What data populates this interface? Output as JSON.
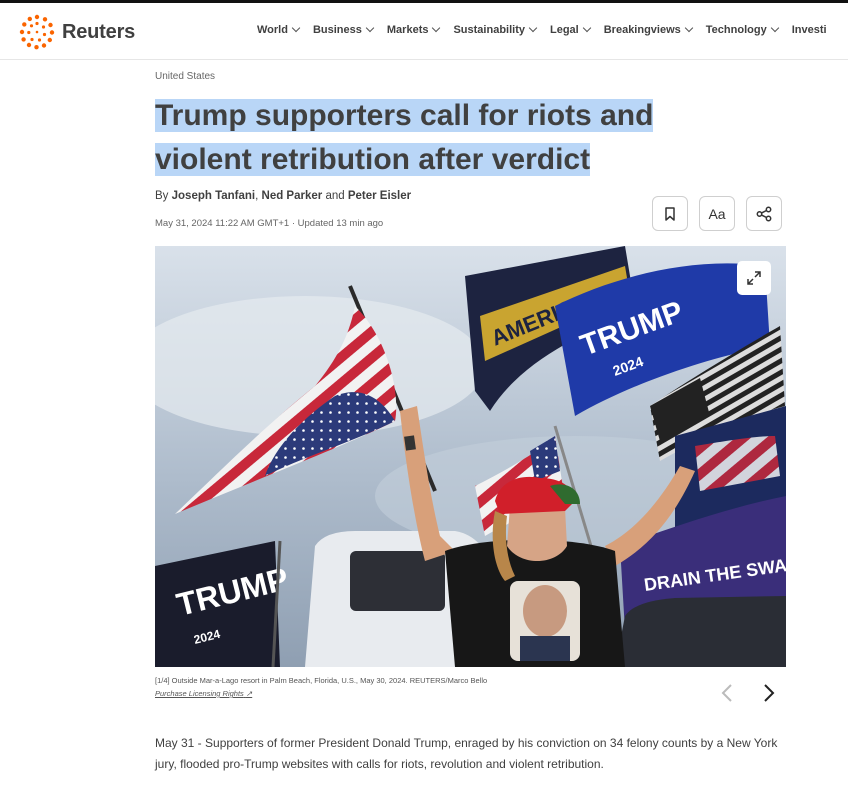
{
  "brand": {
    "name": "Reuters",
    "accent": "#fa6400"
  },
  "nav": {
    "items": [
      {
        "label": "World"
      },
      {
        "label": "Business"
      },
      {
        "label": "Markets"
      },
      {
        "label": "Sustainability"
      },
      {
        "label": "Legal"
      },
      {
        "label": "Breakingviews"
      },
      {
        "label": "Technology"
      },
      {
        "label": "Investi"
      }
    ]
  },
  "article": {
    "kicker": "United States",
    "headline_line1": "Trump supporters call for riots and",
    "headline_line2": "violent retribution after verdict",
    "byline_prefix": "By ",
    "author1": "Joseph Tanfani",
    "sep1": ", ",
    "author2": "Ned Parker",
    "sep2": " and ",
    "author3": "Peter Eisler",
    "dateline": "May 31, 2024 11:22 AM GMT+1 · Updated 13 min ago",
    "tools": {
      "bookmark_icon": "bookmark-icon",
      "text_size_label": "Aa",
      "share_icon": "share-icon"
    },
    "image": {
      "flag_text_1": "AMERICA",
      "flag_text_2": "TRUMP",
      "flag_text_3": "2024",
      "flag_text_4": "DRAIN THE SWAMP",
      "flag_text_5": "TRUMP",
      "flag_text_6": "2024"
    },
    "caption": "[1/4] Outside Mar-a-Lago resort in Palm Beach, Florida, U.S., May 30, 2024. REUTERS/Marco Bello",
    "caption_link": "Purchase Licensing Rights",
    "body": "May 31 - Supporters of former President Donald Trump, enraged by his conviction on 34 felony counts by a New York jury, flooded pro-Trump websites with calls for riots, revolution and violent retribution."
  }
}
